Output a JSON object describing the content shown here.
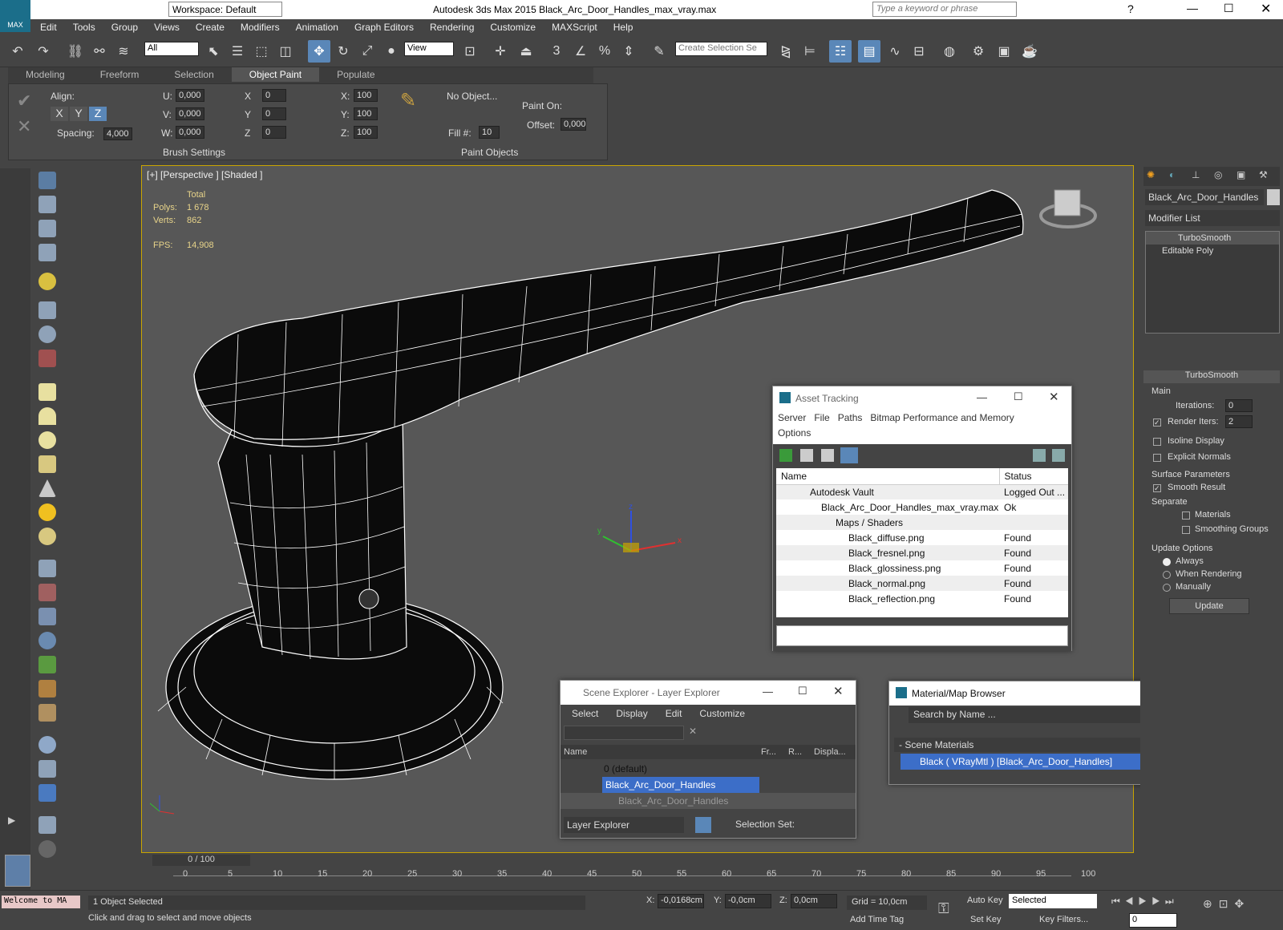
{
  "app": {
    "title": "Autodesk 3ds Max  2015    Black_Arc_Door_Handles_max_vray.max",
    "workspace": "Workspace: Default",
    "search_placeholder": "Type a keyword or phrase",
    "logo": "MAX"
  },
  "menu": [
    "Edit",
    "Tools",
    "Group",
    "Views",
    "Create",
    "Modifiers",
    "Animation",
    "Graph Editors",
    "Rendering",
    "Customize",
    "MAXScript",
    "Help"
  ],
  "toolbar": {
    "filter": "All",
    "view": "View",
    "selection_set": "Create Selection Se"
  },
  "ribbon": {
    "tabs": [
      "Modeling",
      "Freeform",
      "Selection",
      "Object Paint",
      "Populate"
    ],
    "active": "Object Paint",
    "align": "Align:",
    "axes": [
      "X",
      "Y",
      "Z"
    ],
    "spacing_label": "Spacing:",
    "spacing": "4,000",
    "u_label": "U:",
    "v_label": "V:",
    "w_label": "W:",
    "u": "0,000",
    "v": "0,000",
    "w": "0,000",
    "x_label": "X",
    "y_label": "Y",
    "z_label": "Z",
    "x": "0",
    "y": "0",
    "z": "0",
    "sx_label": "X:",
    "sy_label": "Y:",
    "sz_label": "Z:",
    "sx": "100",
    "sy": "100",
    "sz": "100",
    "no_object": "No Object...",
    "fill_label": "Fill #:",
    "fill": "10",
    "paint_on": "Paint On:",
    "offset_label": "Offset:",
    "offset": "0,000",
    "brush_settings": "Brush Settings",
    "paint_objects": "Paint Objects"
  },
  "viewport": {
    "label": "[+] [Perspective ] [Shaded ]",
    "stats_header": "Total",
    "polys_label": "Polys:",
    "polys": "1 678",
    "verts_label": "Verts:",
    "verts": "862",
    "fps_label": "FPS:",
    "fps": "14,908",
    "gizmo": {
      "x": "x",
      "y": "y",
      "z": "z"
    }
  },
  "asset_tracking": {
    "title": "Asset Tracking",
    "menu": [
      "Server",
      "File",
      "Paths",
      "Bitmap Performance and Memory",
      "Options"
    ],
    "columns": [
      "Name",
      "Status"
    ],
    "rows": [
      {
        "name": "Autodesk Vault",
        "status": "Logged Out ..."
      },
      {
        "name": "Black_Arc_Door_Handles_max_vray.max",
        "status": "Ok"
      },
      {
        "name": "Maps / Shaders",
        "status": ""
      },
      {
        "name": "Black_diffuse.png",
        "status": "Found"
      },
      {
        "name": "Black_fresnel.png",
        "status": "Found"
      },
      {
        "name": "Black_glossiness.png",
        "status": "Found"
      },
      {
        "name": "Black_normal.png",
        "status": "Found"
      },
      {
        "name": "Black_reflection.png",
        "status": "Found"
      }
    ]
  },
  "scene_explorer": {
    "title": "Scene Explorer - Layer Explorer",
    "menu": [
      "Select",
      "Display",
      "Edit",
      "Customize"
    ],
    "columns": [
      "Name",
      "Fr...",
      "R...",
      "Displa..."
    ],
    "rows": [
      {
        "name": "0 (default)"
      },
      {
        "name": "Black_Arc_Door_Handles"
      },
      {
        "name": "Black_Arc_Door_Handles"
      }
    ],
    "footer_select": "Layer Explorer",
    "selection_set": "Selection Set:"
  },
  "material_browser": {
    "title": "Material/Map Browser",
    "search": "Search by Name ...",
    "group": "- Scene Materials",
    "item": "Black  ( VRayMtl )  [Black_Arc_Door_Handles]"
  },
  "command_panel": {
    "object_name": "Black_Arc_Door_Handles",
    "modifier_list": "Modifier List",
    "stack": [
      "TurboSmooth",
      "Editable Poly"
    ],
    "rollout": "TurboSmooth",
    "main": "Main",
    "iterations_label": "Iterations:",
    "iterations": "0",
    "render_iters_label": "Render Iters:",
    "render_iters": "2",
    "isoline": "Isoline Display",
    "explicit": "Explicit Normals",
    "surface": "Surface Parameters",
    "smooth_result": "Smooth Result",
    "separate": "Separate",
    "materials": "Materials",
    "smoothing_groups": "Smoothing Groups",
    "update_options": "Update Options",
    "always": "Always",
    "when_rendering": "When Rendering",
    "manually": "Manually",
    "update": "Update"
  },
  "timeline": {
    "frame": "0 / 100",
    "ticks": [
      "0",
      "5",
      "10",
      "15",
      "20",
      "25",
      "30",
      "35",
      "40",
      "45",
      "50",
      "55",
      "60",
      "65",
      "70",
      "75",
      "80",
      "85",
      "90",
      "95",
      "100"
    ]
  },
  "status": {
    "listener": "Welcome to MA",
    "selected": "1 Object Selected",
    "hint": "Click and drag to select and move objects",
    "x_label": "X:",
    "x": "-0,0168cm",
    "y_label": "Y:",
    "y": "-0,0cm",
    "z_label": "Z:",
    "z": "0,0cm",
    "grid": "Grid = 10,0cm",
    "add_time_tag": "Add Time Tag",
    "auto_key": "Auto Key",
    "set_key": "Set Key",
    "selected_dd": "Selected",
    "key_filters": "Key Filters...",
    "frame_field": "0"
  }
}
